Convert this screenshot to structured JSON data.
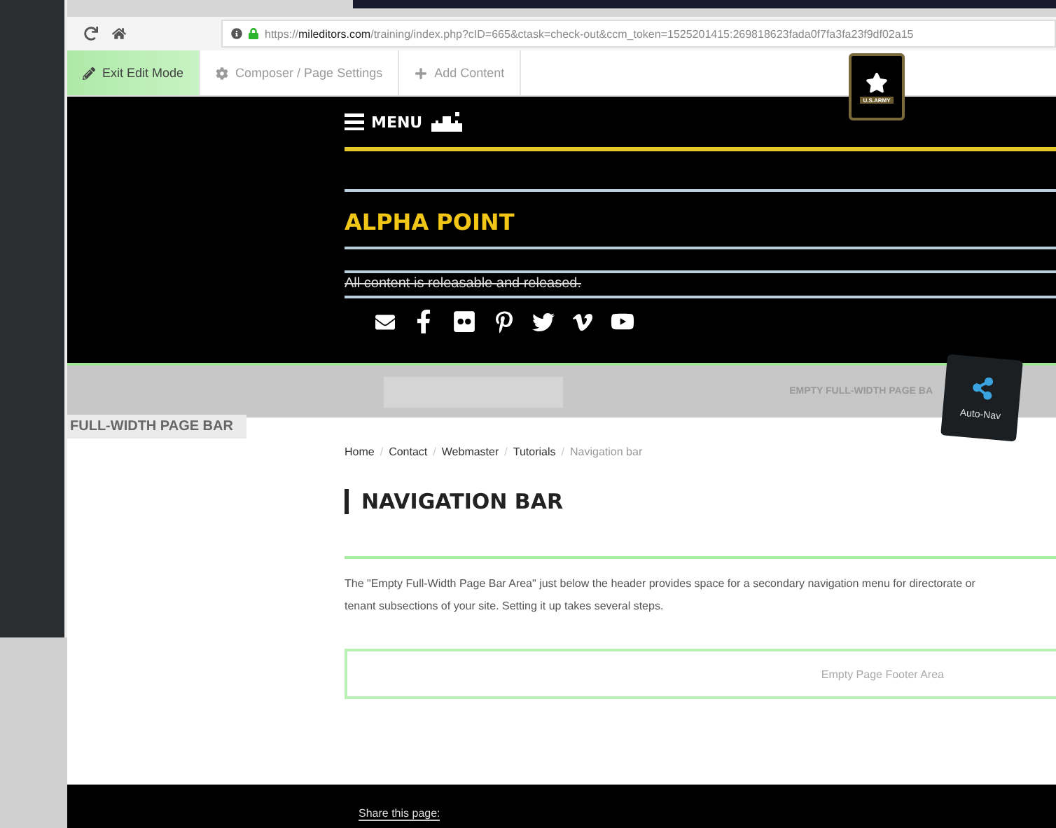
{
  "browser": {
    "url_host": "mileditors.com",
    "url_prefix": "https://",
    "url_rest": "/training/index.php?cID=665&ctask=check-out&ccm_token=1525201415:269818623fada0f7fa3fa23f9df02a15"
  },
  "edit_toolbar": [
    {
      "label": "Exit Edit Mode",
      "selected": true
    },
    {
      "label": "Composer / Page Settings",
      "selected": false
    },
    {
      "label": "Add Content",
      "selected": false
    }
  ],
  "logo": {
    "caption": "U.S.ARMY"
  },
  "header": {
    "menu": "MENU",
    "site_title": "ALPHA POINT",
    "disclaimer": "All content is releasable and released."
  },
  "page_bar": {
    "left_label": "FULL-WIDTH PAGE BAR",
    "right_label": "EMPTY FULL-WIDTH PAGE BA"
  },
  "auto_nav": {
    "label": "Auto-Nav"
  },
  "breadcrumb": [
    {
      "label": "Home",
      "current": false
    },
    {
      "sep": "/",
      "label": "Contact",
      "current": false
    },
    {
      "sep": "/",
      "label": "Webmaster",
      "current": false
    },
    {
      "sep": "/",
      "label": "Tutorials",
      "current": false
    },
    {
      "sep": "/",
      "label": "Navigation bar",
      "current": true
    }
  ],
  "page_title": "NAVIGATION BAR",
  "paragraph": "The \"Empty Full-Width Page Bar Area\" just below the header provides space for a secondary navigation menu for directorate or tenant subsections of your site. Setting it up takes several steps.",
  "footer_area": "Empty Page Footer Area",
  "footer": {
    "share": "Share this page:"
  }
}
